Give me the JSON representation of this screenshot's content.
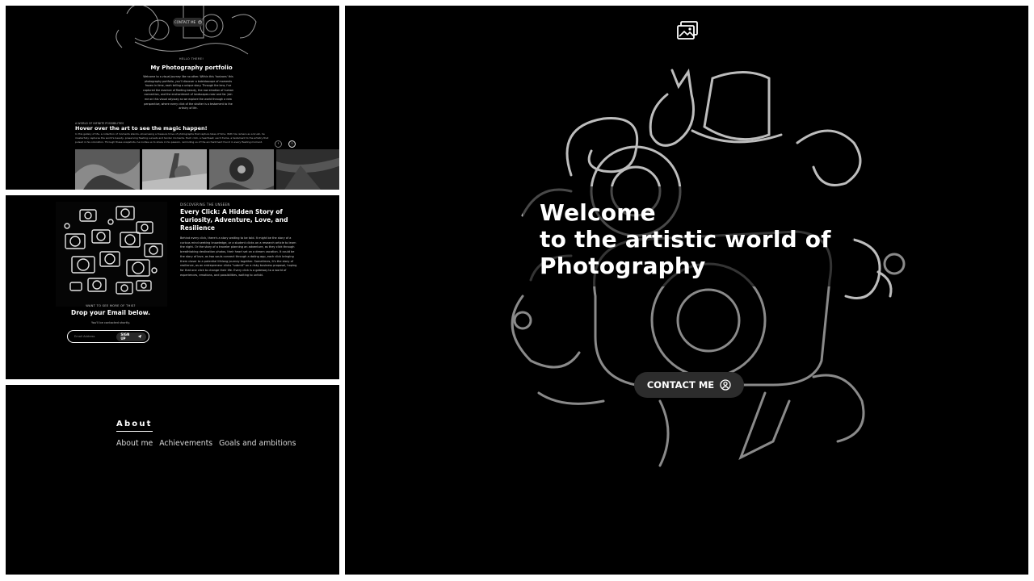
{
  "panel1": {
    "contact_label": "CONTACT ME",
    "eyebrow": "HELLO THERE!",
    "title": "My Photography portfolio",
    "paragraph": "Welcome to a visual journey like no other. Within this 'horizons' this photography portfolio, you'll discover a kaleidoscope of moments frozen in time, each telling a unique story. Through the lens, I've captured the essence of fleeting beauty, the raw emotion of human connection, and the enchantment of landscapes near and far. Join me on this visual odyssey as we explore the world through a new perspective, where every click of the shutter is a testament to the artistry of life.",
    "eyebrow2": "A WORLD OF INFINITE POSSIBILITIES",
    "title2": "Hover over the art to see the magic happen!",
    "paragraph2": "In this gallery of life, a collection of moments stands, showcasing a treasure trove of photographs that capture tales of time. With his camera as a brush, he masterfully captures the world's beauty, preserving fleeting sunsets and tender moments. Each click, a heartbeat; each frame, a testament to the artistry that pulsed in his coloration. Through these snapshots, he invites us to share in his passion, reminding us of the enchantment found in every fleeting moment.",
    "prev_label": "‹",
    "next_label": "›"
  },
  "panel2": {
    "eyebrow": "DISCOVERING THE UNSEEN",
    "title": "Every Click: A Hidden Story of Curiosity, Adventure, Love, and Resilience",
    "paragraph": "Behind every click, there's a story waiting to be told. It might be the story of a curious mind seeking knowledge, or a student clicks on a research article to learn the night. Or the story of a traveler planning an adventure, as they click through breathtaking destination photos, their heart set on a dream vacation. It could be the story of love, as two souls connect through a dating app, each click bringing them closer to a potential lifelong journey together. Sometimes, it's the story of resilience, as an entrepreneur clicks \"submit\" on a risky business proposal, hoping for that one click to change their life. Every click is a gateway to a world of experiences, emotions, and possibilities, waiting to unfold.",
    "question": "WANT TO SEE MORE OF THIS?",
    "drop": "Drop your Email below.",
    "sub": "You'll be contacted shortly.",
    "email_placeholder": "Email Address",
    "signup_label": "SIGN UP"
  },
  "panel3": {
    "heading": "About",
    "links": [
      "About me",
      "Achievements",
      "Goals and ambitions"
    ]
  },
  "panel4": {
    "title_line1": "Welcome",
    "title_line2": "to the artistic world of",
    "title_line3": "Photography",
    "contact_label": "CONTACT ME"
  },
  "icons": {
    "gallery": "gallery-icon",
    "contact": "user-circle-icon",
    "send": "send-icon",
    "prev": "chevron-left-icon",
    "next": "chevron-right-icon"
  }
}
